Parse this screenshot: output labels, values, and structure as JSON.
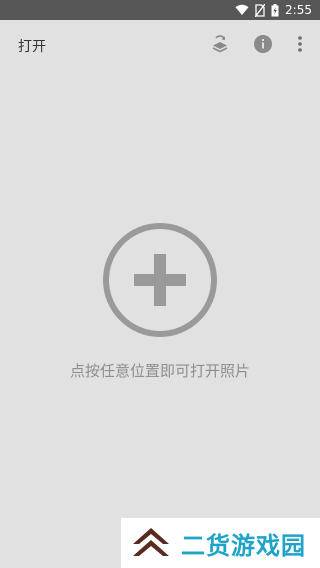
{
  "status_bar": {
    "time": "2:55",
    "icons": [
      "wifi-icon",
      "no-sim-icon",
      "battery-icon"
    ]
  },
  "app_bar": {
    "title": "打开",
    "actions": [
      "layers-refresh-icon",
      "info-icon",
      "more-vert-icon"
    ]
  },
  "main": {
    "hint": "点按任意位置即可打开照片",
    "center_icon": "add-circle-icon"
  },
  "watermark": {
    "text": "二货游戏园",
    "logo": "chevrons-up-logo"
  },
  "colors": {
    "status_bar_bg": "#575757",
    "background": "#e1e1e1",
    "icon_gray": "#9a9a9a",
    "watermark_text": "#1fa4c8",
    "watermark_logo": "#5a2a1e"
  }
}
